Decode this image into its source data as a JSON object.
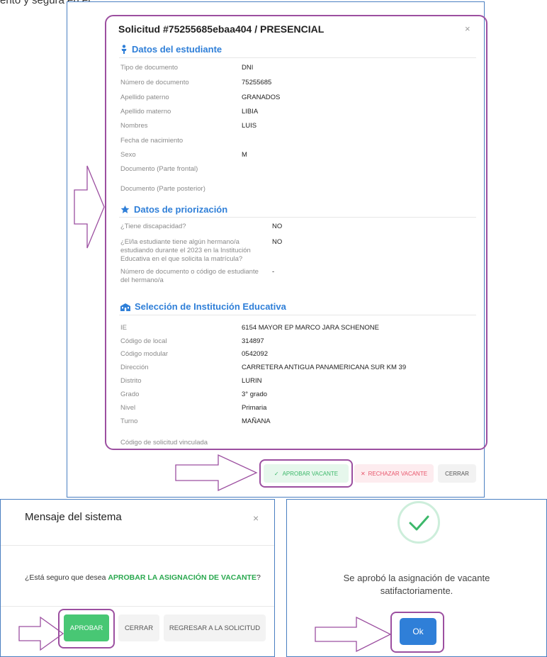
{
  "top_cut_text": "ento y segura en el",
  "modal": {
    "title": "Solicitud #75255685ebaa404 / PRESENCIAL",
    "close": "×"
  },
  "student": {
    "heading": "Datos del estudiante",
    "rows": [
      {
        "label": "Tipo de documento",
        "value": "DNI"
      },
      {
        "label": "Número de documento",
        "value": "75255685"
      },
      {
        "label": "Apellido paterno",
        "value": "GRANADOS"
      },
      {
        "label": "Apellido materno",
        "value": "LIBIA"
      },
      {
        "label": "Nombres",
        "value": "LUIS"
      },
      {
        "label": "Fecha de nacimiento",
        "value": ""
      },
      {
        "label": "Sexo",
        "value": "M"
      },
      {
        "label": "Documento (Parte frontal)",
        "value": ""
      },
      {
        "label": "Documento (Parte posterior)",
        "value": ""
      }
    ]
  },
  "priority": {
    "heading": "Datos de priorización",
    "rows": [
      {
        "label": "¿Tiene discapacidad?",
        "value": "NO"
      },
      {
        "label": "¿El/la estudiante tiene algún hermano/a estudiando durante el 2023 en la Institución Educativa en el que solicita la matrícula?",
        "value": "NO"
      },
      {
        "label": "Número de documento o código de estudiante del hermano/a",
        "value": "-"
      }
    ]
  },
  "school": {
    "heading": "Selección de Institución Educativa",
    "rows": [
      {
        "label": "IE",
        "value": "6154 MAYOR EP MARCO JARA SCHENONE"
      },
      {
        "label": "Código de local",
        "value": "314897"
      },
      {
        "label": "Código modular",
        "value": "0542092"
      },
      {
        "label": "Dirección",
        "value": "CARRETERA ANTIGUA PANAMERICANA SUR KM 39"
      },
      {
        "label": "Distrito",
        "value": "LURIN"
      },
      {
        "label": "Grado",
        "value": "3° grado"
      },
      {
        "label": "Nivel",
        "value": "Primaria"
      },
      {
        "label": "Turno",
        "value": "MAÑANA"
      },
      {
        "label": "Código de solicitud vinculada",
        "value": ""
      }
    ]
  },
  "actions": {
    "approve": "APROBAR VACANTE",
    "reject": "RECHAZAR VACANTE",
    "close": "CERRAR"
  },
  "confirm_dialog": {
    "title": "Mensaje del sistema",
    "close": "×",
    "message_pre": "¿Está seguro que desea ",
    "message_strong": "APROBAR LA ASIGNACIÓN DE VACANTE",
    "message_post": "?",
    "approve": "APROBAR",
    "close_btn": "CERRAR",
    "back": "REGRESAR A LA SOLICITUD"
  },
  "success_dialog": {
    "message_line1": "Se aprobó la asignación de vacante",
    "message_line2": "satifactoriamente.",
    "ok": "Ok"
  },
  "colors": {
    "accent_blue": "#2f7fd8",
    "approve_green": "#48c774",
    "reject_red": "#e8556b",
    "highlight_purple": "#9c4fa0"
  }
}
